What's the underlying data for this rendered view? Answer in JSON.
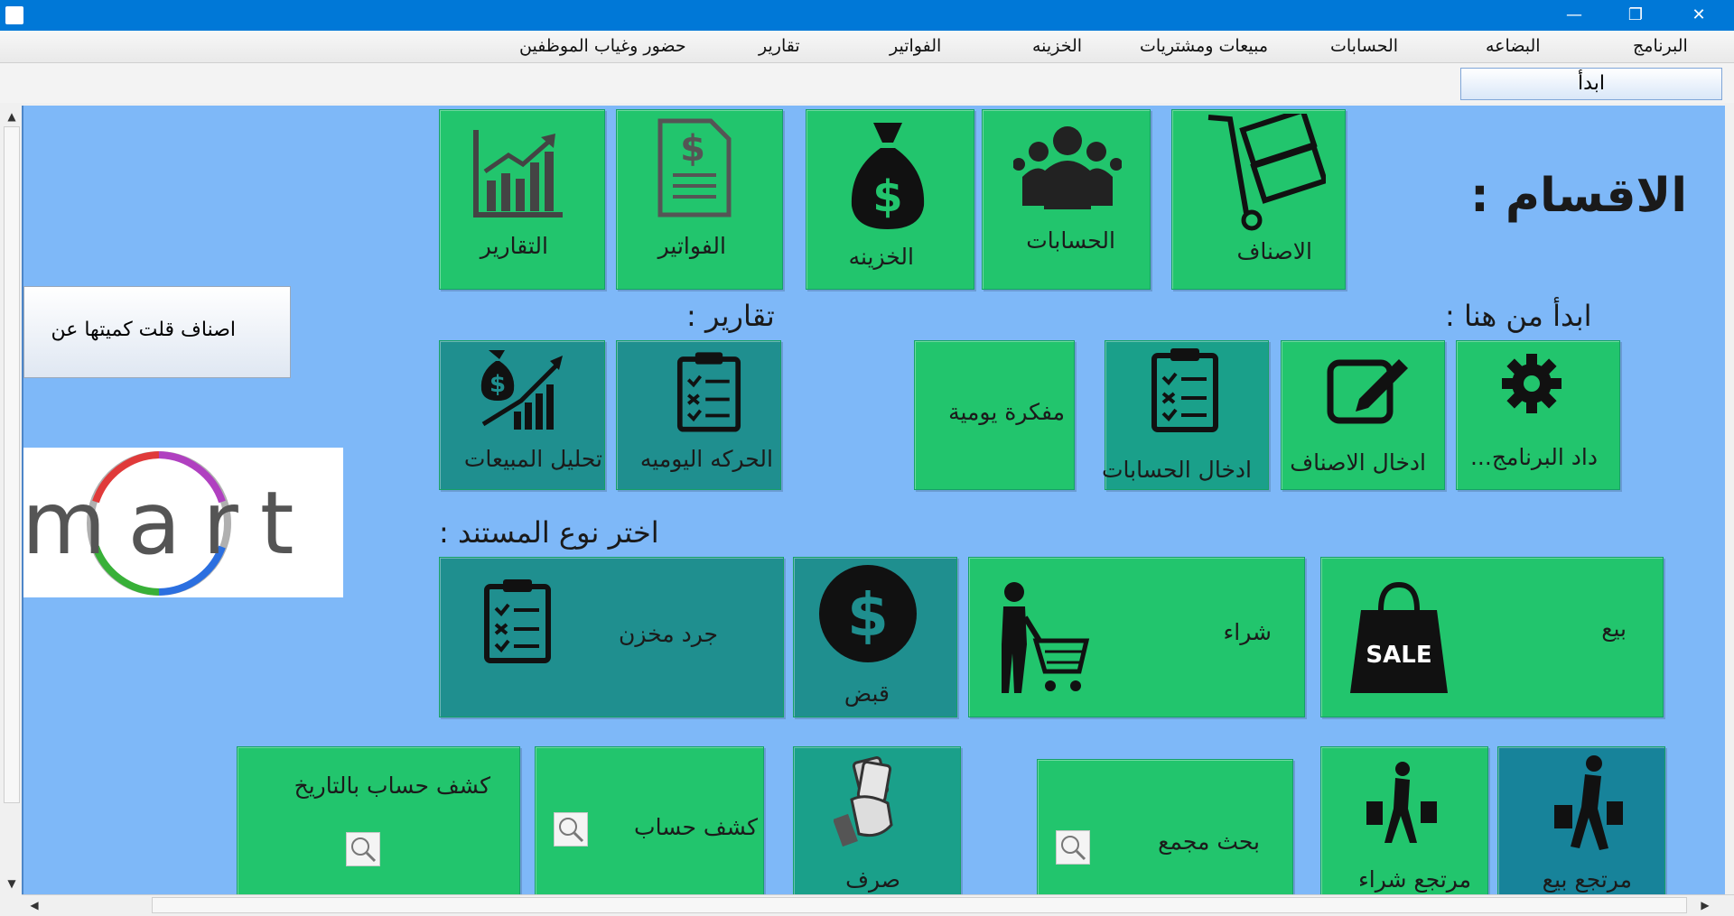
{
  "window": {
    "controls": {
      "minimize": "—",
      "restore": "❐",
      "close": "✕"
    }
  },
  "menubar": {
    "items": [
      "البرنامج",
      "البضاعه",
      "الحسابات",
      "مبيعات ومشتريات",
      "الخزينه",
      "الفواتير",
      "تقارير",
      "حضور وغياب الموظفين"
    ]
  },
  "tabs": {
    "active": "ابدأ"
  },
  "side": {
    "low_stock_button": "اصناف قلت كميتها عن",
    "logo_text": "mart"
  },
  "sections": {
    "heading": "الاقسام :",
    "tiles": [
      "الاصناف",
      "الحسابات",
      "الخزينه",
      "الفواتير",
      "التقارير"
    ]
  },
  "start_here": {
    "heading": "ابدأ من هنا :",
    "tiles": [
      "داد البرنامج...",
      "ادخال الاصناف",
      "ادخال الحسابات",
      "مفكرة يومية"
    ]
  },
  "reports": {
    "heading": "تقارير :",
    "tiles": [
      "الحركه اليوميه",
      "تحليل المبيعات"
    ]
  },
  "documents": {
    "heading": "اختر نوع المستند :",
    "tiles": [
      "بيع",
      "شراء",
      "قبض",
      "جرد مخزن"
    ],
    "sale_badge": "SALE"
  },
  "bottom": {
    "tiles": [
      "مرتجع بيع",
      "مرتجع شراء",
      "بحث مجمع",
      "صرف",
      "كشف حساب",
      "كشف حساب بالتاريخ"
    ]
  }
}
